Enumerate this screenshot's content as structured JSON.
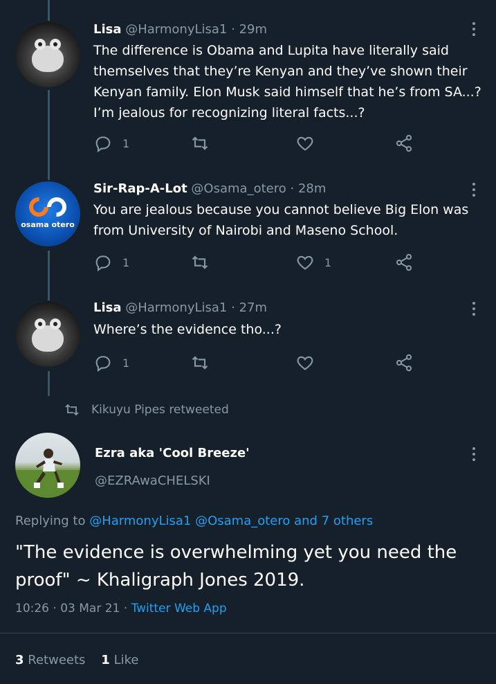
{
  "tweets": [
    {
      "name": "Lisa",
      "handle": "@HarmonyLisa1",
      "time": "29m",
      "text": "The difference is Obama and Lupita have literally said themselves that they’re Kenyan and they’ve shown their Kenyan family. Elon Musk said himself that he’s from SA...? I’m jealous for recognizing literal facts...?",
      "replies": "1",
      "likes": ""
    },
    {
      "name": "Sir-Rap-A-Lot",
      "handle": "@Osama_otero",
      "time": "28m",
      "text": "You are jealous because you cannot believe Big Elon was from University of Nairobi and Maseno School.",
      "replies": "1",
      "likes": "1",
      "avatar_text": "osama otero"
    },
    {
      "name": "Lisa",
      "handle": "@HarmonyLisa1",
      "time": "27m",
      "text": "Where’s the evidence tho...?",
      "replies": "1",
      "likes": ""
    }
  ],
  "retweet_notice": "Kikuyu Pipes retweeted",
  "main": {
    "name": "Ezra aka 'Cool Breeze'",
    "handle": "@EZRAwaCHELSKI",
    "replying_label": "Replying to",
    "replying_users": "@HarmonyLisa1 @Osama_otero and 7 others",
    "text": "\"The evidence is overwhelming yet you need the proof\" ~ Khaligraph Jones 2019.",
    "timestamp": "10:26 · 03 Mar 21 ·",
    "source": "Twitter Web App",
    "retweets_count": "3",
    "retweets_label": "Retweets",
    "likes_count": "1",
    "likes_label": "Like"
  },
  "colors": {
    "background": "#15202b",
    "secondary_text": "#8899a6",
    "link": "#1da1f2",
    "thread_line": "#3d5466"
  }
}
